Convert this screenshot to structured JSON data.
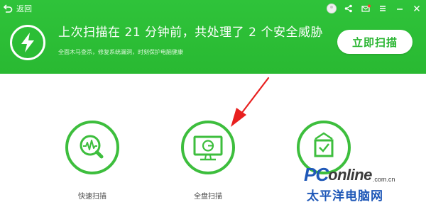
{
  "titlebar": {
    "back_label": "返回",
    "controls": [
      {
        "icon": "avatar-icon"
      },
      {
        "icon": "share-icon"
      },
      {
        "icon": "mail-icon"
      },
      {
        "icon": "menu-icon"
      },
      {
        "icon": "minimize-icon"
      },
      {
        "icon": "close-icon"
      }
    ]
  },
  "header": {
    "summary_prefix": "上次扫描在",
    "minutes": "21",
    "summary_mid": "分钟前，共处理了",
    "items": "2",
    "summary_suffix": "个安全威胁",
    "subtitle": "全面木马查杀，修复系统漏洞，时刻保护电脑健康",
    "scan_button": "立即扫描"
  },
  "modes": [
    {
      "label": "快速扫描",
      "icon": "quick-scan-icon"
    },
    {
      "label": "全盘扫描",
      "icon": "full-scan-icon"
    },
    {
      "label": "",
      "icon": "custom-scan-icon"
    }
  ],
  "watermark": {
    "brand_pc": "PC",
    "brand_online": "online",
    "domain": ".com.cn",
    "chinese": "太平洋电脑网"
  },
  "colors": {
    "brand_green": "#2fc33a",
    "icon_green": "#3dbe3d",
    "annotation_red": "#e8201f",
    "watermark_blue": "#1f58b8"
  }
}
